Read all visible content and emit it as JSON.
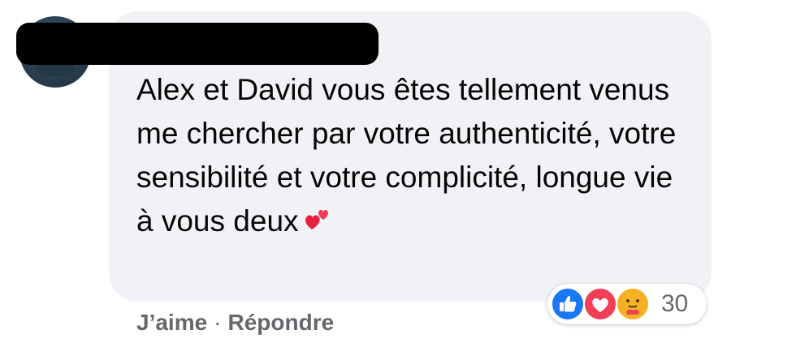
{
  "comment": {
    "author_redacted": true,
    "text": "Alex et David vous êtes tellement venus me chercher par votre authenticité, votre sensibilité et votre complicité, longue vie à vous deux",
    "emoji": "two-hearts-icon"
  },
  "reactions": {
    "icons": [
      "like-icon",
      "love-icon",
      "care-icon"
    ],
    "count": "30",
    "colors": {
      "like": "#1877f2",
      "love": "#f33e58",
      "care": "#f7b125"
    }
  },
  "actions": {
    "like_label": "J’aime",
    "separator": "·",
    "reply_label": "Répondre"
  },
  "colors": {
    "bubble_bg": "#f0f2f5",
    "text": "#050505",
    "secondary_text": "#65676b"
  }
}
